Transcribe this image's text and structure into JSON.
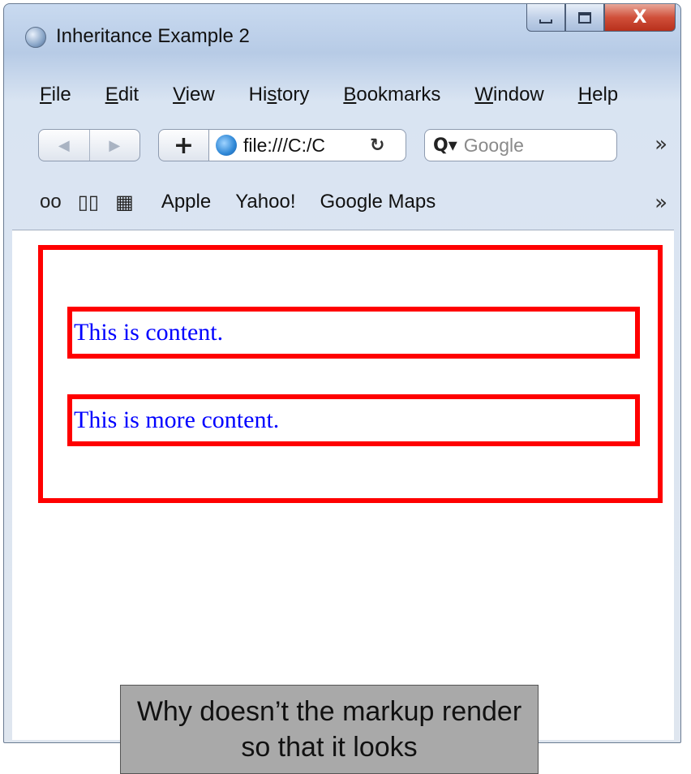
{
  "window": {
    "title": "Inheritance Example 2",
    "close_glyph": "X"
  },
  "menu": {
    "items": [
      "File",
      "Edit",
      "View",
      "History",
      "Bookmarks",
      "Window",
      "Help"
    ],
    "mnemonics": [
      "F",
      "E",
      "V",
      "s",
      "B",
      "W",
      "H"
    ]
  },
  "toolbar": {
    "back_glyph": "◀",
    "forward_glyph": "▶",
    "add_glyph": "+",
    "url": "file:///C:/C",
    "reload_glyph": "↻",
    "search_placeholder": "Google",
    "search_glyph": "Q▾",
    "overflow_glyph": "»"
  },
  "bookmarks": {
    "reading_list_glyph": "oo",
    "book_glyph": "▯▯",
    "grid_glyph": "▦",
    "links": [
      "Apple",
      "Yahoo!",
      "Google Maps"
    ],
    "overflow_glyph": "»"
  },
  "page": {
    "content_1": "This is content.",
    "content_2": "This is more content.",
    "border_color": "#ff0000",
    "text_color": "#0000ff"
  },
  "caption": {
    "text": "Why doesn’t the markup render so that it looks"
  }
}
